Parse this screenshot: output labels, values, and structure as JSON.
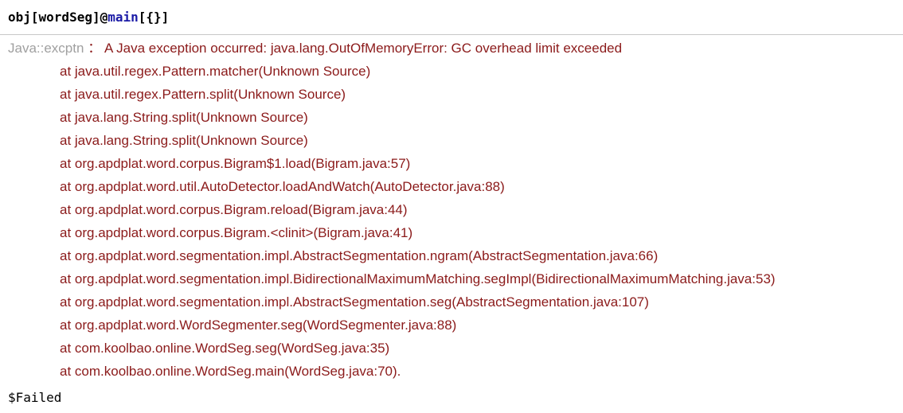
{
  "input": {
    "prefix": "obj[wordSeg]@",
    "keyword": "main",
    "suffix": "[{}]"
  },
  "message": {
    "tag": "Java::excptn",
    "separator": "：",
    "text": "A Java exception occurred: java.lang.OutOfMemoryError: GC overhead limit exceeded",
    "trace": [
      "at java.util.regex.Pattern.matcher(Unknown Source)",
      "at java.util.regex.Pattern.split(Unknown Source)",
      "at java.lang.String.split(Unknown Source)",
      "at java.lang.String.split(Unknown Source)",
      "at org.apdplat.word.corpus.Bigram$1.load(Bigram.java:57)",
      "at org.apdplat.word.util.AutoDetector.loadAndWatch(AutoDetector.java:88)",
      "at org.apdplat.word.corpus.Bigram.reload(Bigram.java:44)",
      "at org.apdplat.word.corpus.Bigram.<clinit>(Bigram.java:41)",
      "at org.apdplat.word.segmentation.impl.AbstractSegmentation.ngram(AbstractSegmentation.java:66)",
      "at org.apdplat.word.segmentation.impl.BidirectionalMaximumMatching.segImpl(BidirectionalMaximumMatching.java:53)",
      "at org.apdplat.word.segmentation.impl.AbstractSegmentation.seg(AbstractSegmentation.java:107)",
      "at org.apdplat.word.WordSegmenter.seg(WordSegmenter.java:88)",
      "at com.koolbao.online.WordSeg.seg(WordSeg.java:35)",
      "at com.koolbao.online.WordSeg.main(WordSeg.java:70)."
    ]
  },
  "output": {
    "result": "$Failed"
  }
}
